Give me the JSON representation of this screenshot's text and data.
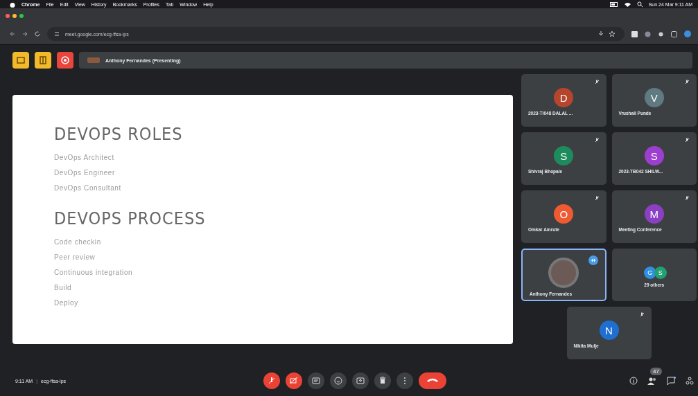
{
  "menu_bar": {
    "items": [
      "Chrome",
      "File",
      "Edit",
      "View",
      "History",
      "Bookmarks",
      "Profiles",
      "Tab",
      "Window",
      "Help"
    ],
    "clock": "Sun 24 Mar 9:11 AM"
  },
  "browser": {
    "address": "meet.google.com/ecg-ffsa-ips"
  },
  "presenter_bar": {
    "label": "Anthony Fernandes (Presenting)"
  },
  "slide": {
    "sections": [
      {
        "heading": "DEVOPS ROLES",
        "items": [
          "DevOps Architect",
          "DevOps Engineer",
          "DevOps Consultant"
        ]
      },
      {
        "heading": "DEVOPS PROCESS",
        "items": [
          "Code checkin",
          "Peer review",
          "Continuous integration",
          "Build",
          "Deploy"
        ]
      }
    ]
  },
  "tiles": [
    {
      "kind": "avatar",
      "initial": "D",
      "name": "2023-TI048 DALAL ...",
      "color": "#b5462c",
      "speaking": false
    },
    {
      "kind": "avatar",
      "initial": "V",
      "name": "Vrushali Punde",
      "color": "#5f7a80",
      "speaking": false
    },
    {
      "kind": "avatar",
      "initial": "S",
      "name": "Shivraj Bhopale",
      "color": "#1e8b5c",
      "speaking": false
    },
    {
      "kind": "avatar",
      "initial": "S",
      "name": "2023-TB042 SHILW...",
      "color": "#9c3fcf",
      "speaking": false
    },
    {
      "kind": "avatar",
      "initial": "O",
      "name": "Omkar Amrute",
      "color": "#f05a32",
      "speaking": false
    },
    {
      "kind": "avatar",
      "initial": "M",
      "name": "Meeting Conference",
      "color": "#8b3fc2",
      "speaking": false
    },
    {
      "kind": "photo",
      "name": "Anthony Fernandes",
      "speaking": true
    },
    {
      "kind": "others",
      "name": "29 others",
      "speaking": false,
      "avatars": [
        {
          "initial": "G",
          "color": "#2f8fe0"
        },
        {
          "initial": "S",
          "color": "#23a071"
        }
      ]
    },
    {
      "kind": "avatar",
      "initial": "N",
      "name": "Nikita Mulje",
      "color": "#1f6fd1",
      "speaking": false
    }
  ],
  "bottom_bar": {
    "time": "9:11 AM",
    "separator": "|",
    "code": "ecg-ffsa-ips",
    "participants_badge": "47"
  }
}
